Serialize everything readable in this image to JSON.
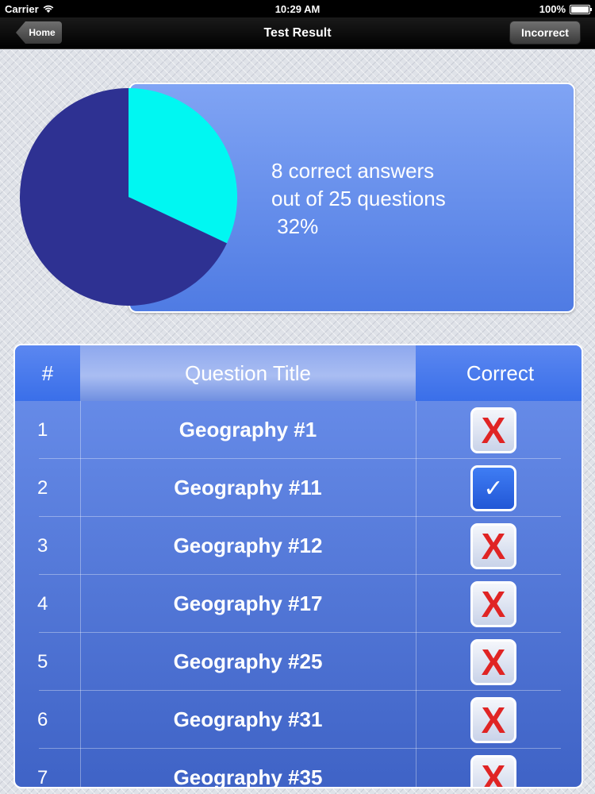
{
  "status_bar": {
    "carrier": "Carrier",
    "time": "10:29 AM",
    "battery": "100%"
  },
  "nav": {
    "title": "Test Result",
    "home_label": "Home",
    "incorrect_label": "Incorrect"
  },
  "summary": {
    "line1": "8 correct answers",
    "line2": "out of 25 questions",
    "line3": " 32%"
  },
  "chart_data": {
    "type": "pie",
    "title": "",
    "slices": [
      {
        "name": "",
        "value": 8,
        "color": "#00f7f2"
      },
      {
        "name": "",
        "value": 17,
        "color": "#2e3192"
      }
    ]
  },
  "table": {
    "headers": {
      "num": "#",
      "title": "Question Title",
      "correct": "Correct"
    },
    "rows": [
      {
        "num": "1",
        "title": "Geography #1",
        "correct": false
      },
      {
        "num": "2",
        "title": "Geography #11",
        "correct": true
      },
      {
        "num": "3",
        "title": "Geography #12",
        "correct": false
      },
      {
        "num": "4",
        "title": "Geography #17",
        "correct": false
      },
      {
        "num": "5",
        "title": "Geography #25",
        "correct": false
      },
      {
        "num": "6",
        "title": "Geography #31",
        "correct": false
      },
      {
        "num": "7",
        "title": "Geography #35",
        "correct": false
      }
    ]
  },
  "icons": {
    "wrong": "X",
    "right": "✓"
  }
}
